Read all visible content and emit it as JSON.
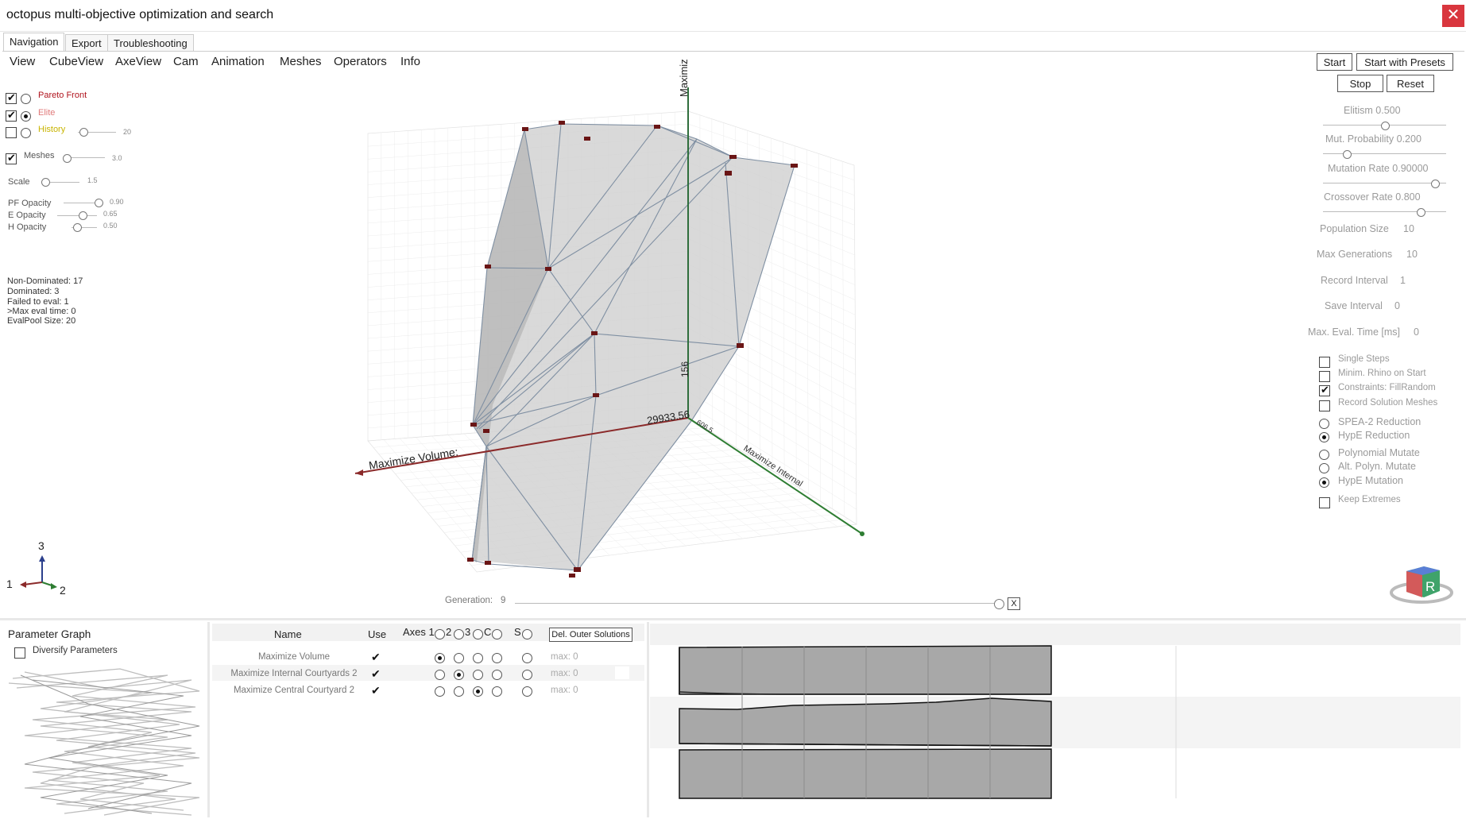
{
  "window": {
    "title": "octopus multi-objective optimization and search",
    "close_glyph": "✕"
  },
  "tabs": [
    "Navigation",
    "Export",
    "Troubleshooting"
  ],
  "menu": [
    "View",
    "CubeView",
    "AxeView",
    "Cam",
    "Animation",
    "Meshes",
    "Operators",
    "Info"
  ],
  "display": {
    "pareto_front": {
      "label": "Pareto Front",
      "color": "#b0141e",
      "checked": true,
      "radio": false
    },
    "elite": {
      "label": "Elite",
      "color": "#e07a7a",
      "checked": true,
      "radio": true
    },
    "history": {
      "label": "History",
      "color": "#c8b400",
      "checked": false,
      "radio": false,
      "value": "20"
    },
    "meshes": {
      "label": "Meshes",
      "checked": true,
      "value": "3.0"
    },
    "scale": {
      "label": "Scale",
      "value": "1.5"
    },
    "pf_opacity": {
      "label": "PF Opacity",
      "value": "0.90"
    },
    "e_opacity": {
      "label": "E Opacity",
      "value": "0.65"
    },
    "h_opacity": {
      "label": "H Opacity",
      "value": "0.50"
    }
  },
  "stats": [
    "Non-Dominated: 17",
    "Dominated: 3",
    "Failed to eval: 1",
    ">Max eval time: 0",
    "EvalPool Size: 20"
  ],
  "viewport": {
    "axis_x_label": "Maximize Volume:",
    "axis_y_label": "Maximiz",
    "axis_z_label": "Maximize Internal",
    "value_x": "29933.56",
    "value_y": "156",
    "value_z": "606.5",
    "generation_label": "Generation:",
    "generation_value": "9",
    "gen_close": "X",
    "gizmo": {
      "axis1": "1",
      "axis2": "2",
      "axis3": "3"
    },
    "cube_letter": "R"
  },
  "controls": {
    "start": "Start",
    "start_presets": "Start with Presets",
    "stop": "Stop",
    "reset": "Reset",
    "elitism": "Elitism  0.500",
    "mut_probability": "Mut. Probability 0.200",
    "mutation_rate": "Mutation Rate  0.90000",
    "crossover_rate": "Crossover Rate  0.800",
    "population_size": {
      "label": "Population Size",
      "value": "10"
    },
    "max_generations": {
      "label": "Max Generations",
      "value": "10"
    },
    "record_interval": {
      "label": "Record Interval",
      "value": "1"
    },
    "save_interval": {
      "label": "Save Interval",
      "value": "0"
    },
    "max_eval_time": {
      "label": "Max. Eval. Time [ms]",
      "value": "0"
    },
    "options": [
      {
        "label": "Single Steps",
        "kind": "check",
        "checked": false
      },
      {
        "label": "Minim. Rhino on Start",
        "kind": "check",
        "checked": false
      },
      {
        "label": "Constraints: FillRandom",
        "kind": "check",
        "checked": true
      },
      {
        "label": "Record Solution Meshes",
        "kind": "check",
        "checked": false
      },
      {
        "label": "SPEA-2 Reduction",
        "kind": "radio",
        "checked": false
      },
      {
        "label": "HypE Reduction",
        "kind": "radio",
        "checked": true
      },
      {
        "label": "Polynomial Mutate",
        "kind": "radio",
        "checked": false
      },
      {
        "label": "Alt. Polyn. Mutate",
        "kind": "radio",
        "checked": false
      },
      {
        "label": "HypE Mutation",
        "kind": "radio",
        "checked": true
      },
      {
        "label": "Keep Extremes",
        "kind": "check",
        "checked": false
      }
    ]
  },
  "param_graph": {
    "title": "Parameter Graph",
    "diversify": "Diversify Parameters"
  },
  "objectives": {
    "header_name": "Name",
    "header_use": "Use",
    "header_axes": "Axes 1",
    "axes_cols": [
      "2",
      "3",
      "C",
      "S"
    ],
    "del_button": "Del. Outer Solutions",
    "rows": [
      {
        "name": "Maximize Volume",
        "use": "✔",
        "selected_axis": 0,
        "max": "max: 0"
      },
      {
        "name": "Maximize Internal Courtyards 2",
        "use": "✔",
        "selected_axis": 1,
        "max": "max: 0"
      },
      {
        "name": "Maximize Central Courtyard 2",
        "use": "✔",
        "selected_axis": 2,
        "max": "max: 0"
      }
    ]
  },
  "colors": {
    "accent_red": "#8b2a2a",
    "axis_green": "#2e7d32",
    "close_red": "#d9363e",
    "mesh_fill": "#c8c8c8"
  }
}
